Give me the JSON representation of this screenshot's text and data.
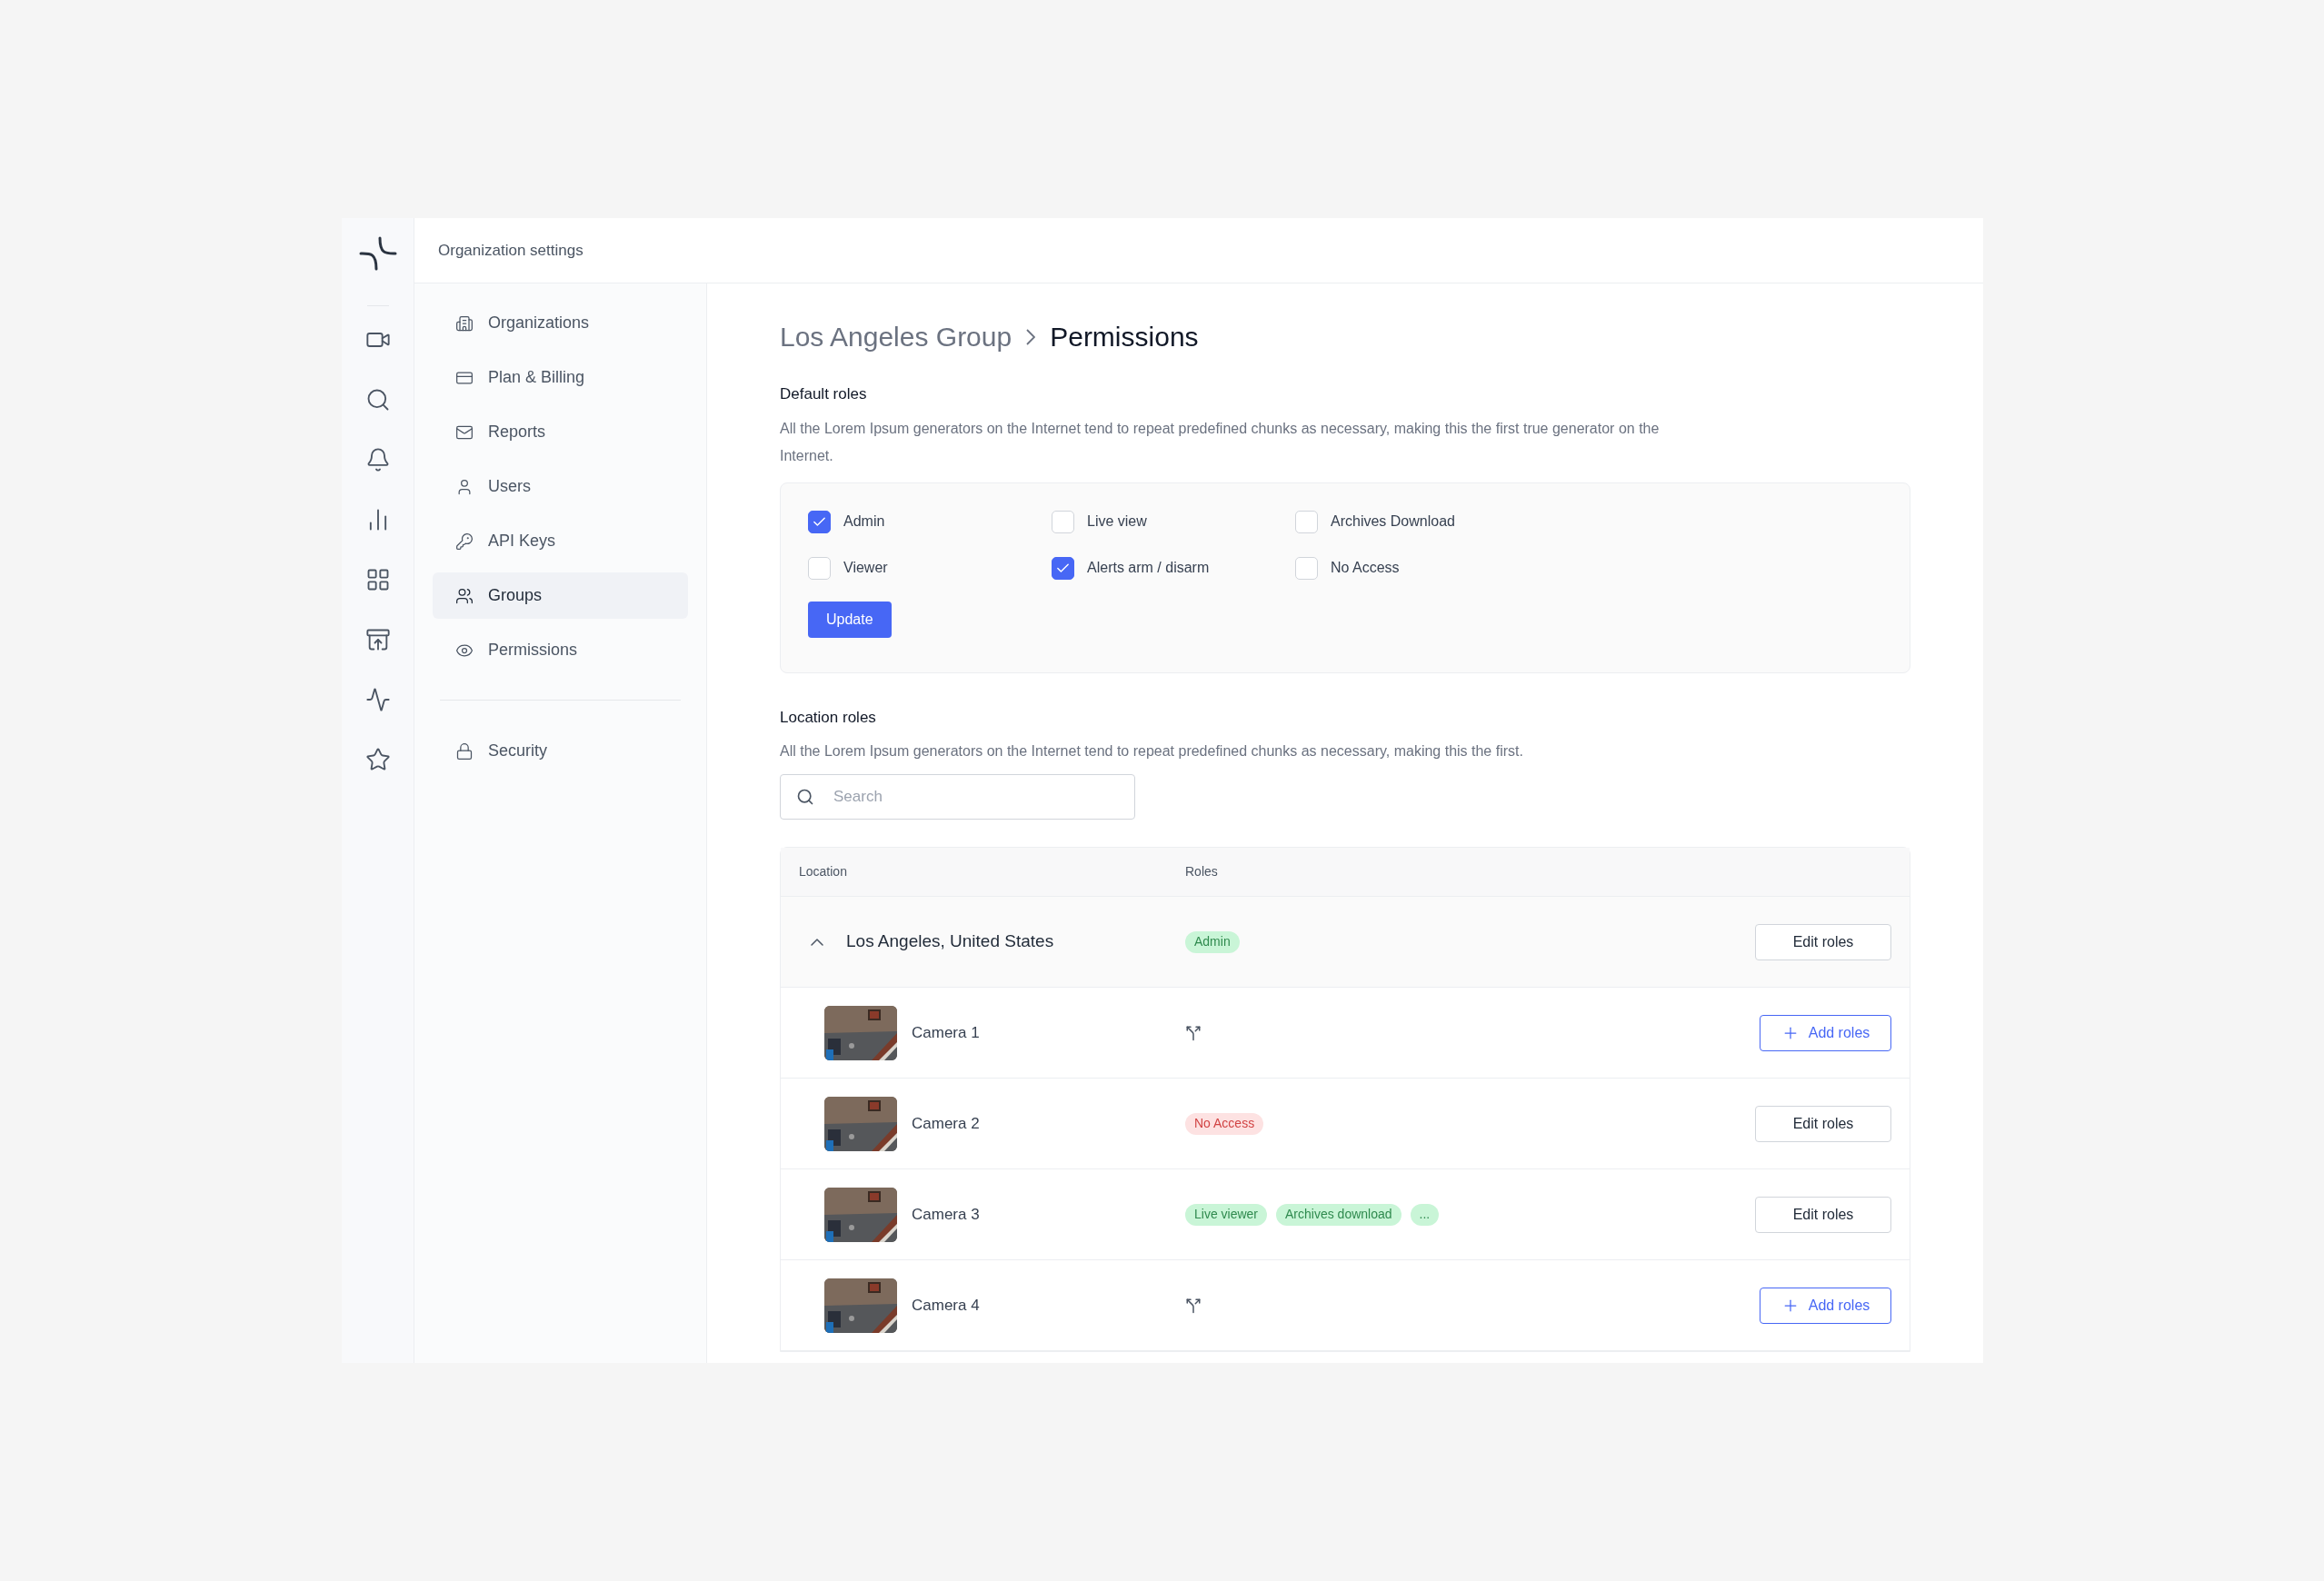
{
  "header": {
    "title": "Organization settings"
  },
  "rail": [
    {
      "kind": "video",
      "selected": false
    },
    {
      "kind": "search",
      "selected": false
    },
    {
      "kind": "bell",
      "selected": false
    },
    {
      "kind": "chart",
      "selected": false
    },
    {
      "kind": "grid",
      "selected": false
    },
    {
      "kind": "download",
      "selected": false
    },
    {
      "kind": "pulse",
      "selected": false
    },
    {
      "kind": "star",
      "selected": false
    }
  ],
  "nav": [
    {
      "label": "Organizations",
      "kind": "building",
      "selected": false
    },
    {
      "label": "Plan & Billing",
      "kind": "card",
      "selected": false
    },
    {
      "label": "Reports",
      "kind": "mail",
      "selected": false
    },
    {
      "label": "Users",
      "kind": "user",
      "selected": false
    },
    {
      "label": "API Keys",
      "kind": "key",
      "selected": false
    },
    {
      "label": "Groups",
      "kind": "group",
      "selected": true
    },
    {
      "label": "Permissions",
      "kind": "eye",
      "selected": false
    }
  ],
  "nav_bottom": [
    {
      "label": "Security",
      "kind": "lock",
      "selected": false
    }
  ],
  "breadcrumb": [
    {
      "label": "Los Angeles Group",
      "current": false
    },
    {
      "label": "Permissions",
      "current": true
    }
  ],
  "default_roles": {
    "title": "Default roles",
    "description": "All the Lorem Ipsum generators on the Internet tend to repeat predefined chunks as necessary, making this the first true generator on the Internet.",
    "options": [
      {
        "label": "Admin",
        "checked": true
      },
      {
        "label": "Live view",
        "checked": false
      },
      {
        "label": "Archives Download",
        "checked": false
      },
      {
        "label": "Viewer",
        "checked": false
      },
      {
        "label": "Alerts arm / disarm",
        "checked": true
      },
      {
        "label": "No Access",
        "checked": false
      }
    ],
    "button": "Update"
  },
  "location_roles": {
    "title": "Location roles",
    "description": "All the Lorem Ipsum generators on the Internet tend to repeat predefined chunks as necessary, making this the first.",
    "search": {
      "placeholder": "Search"
    },
    "table": {
      "columns": [
        "Location",
        "Roles"
      ],
      "rows": [
        {
          "kind": "location",
          "name": "Los Angeles, United States",
          "expanded": true,
          "roles": [
            {
              "label": "Admin",
              "color": "#c9f5d7"
            }
          ],
          "action": {
            "kind": "edit",
            "label": "Edit roles"
          }
        },
        {
          "kind": "camera",
          "name": "Camera 1",
          "thumbnail": {
            "kind": "picture"
          },
          "action": {
            "kind": "add",
            "label": "Add roles"
          }
        },
        {
          "kind": "camera",
          "name": "Camera 2",
          "thumbnail": {
            "kind": "picture"
          },
          "roles": [
            {
              "label": "No Access",
              "color": "#fde2e2"
            }
          ],
          "action": {
            "kind": "edit",
            "label": "Edit roles"
          }
        },
        {
          "kind": "camera",
          "name": "Camera 3",
          "thumbnail": {
            "kind": "picture"
          },
          "roles": [
            {
              "label": "Live viewer",
              "color": "#c9f5d7"
            },
            {
              "label": "Archives download",
              "color": "#c9f5d7"
            },
            {
              "label": "...",
              "color": "#c9f5d7"
            }
          ],
          "action": {
            "kind": "edit",
            "label": "Edit roles"
          }
        },
        {
          "kind": "camera",
          "name": "Camera 4",
          "thumbnail": {
            "kind": "picture"
          },
          "action": {
            "kind": "add",
            "label": "Add roles"
          }
        }
      ]
    }
  }
}
